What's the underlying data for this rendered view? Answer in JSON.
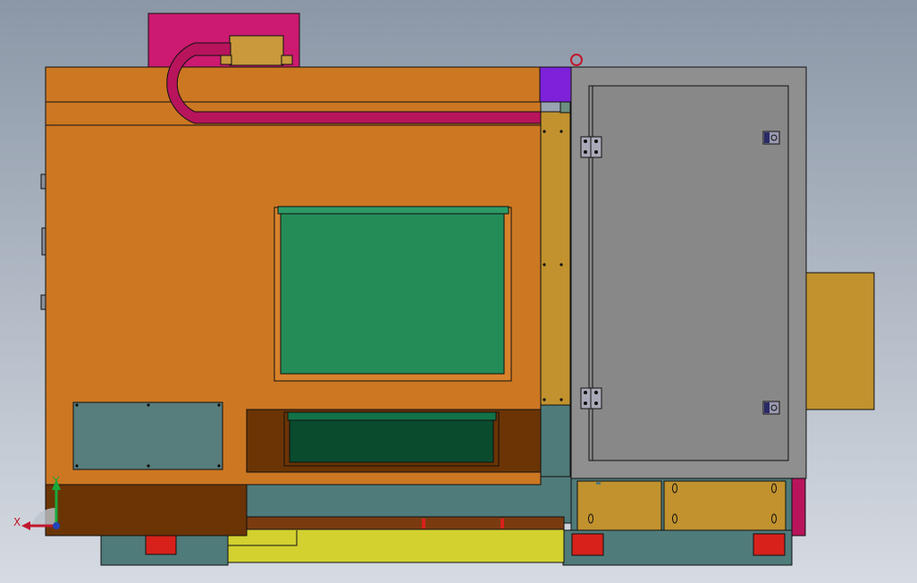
{
  "view": {
    "kind": "cad-orthographic-view",
    "background": [
      "#8b97a7",
      "#d6dbe2"
    ]
  },
  "triad": {
    "x_label": "X",
    "y_label": "Y",
    "x_color": "#c0192c",
    "y_color": "#19a83b"
  },
  "colors": {
    "enclosure_orange": "#cc7722",
    "trim_orange": "#d9822b",
    "cable_chain": "#b8145c",
    "magenta_plate": "#cc1a70",
    "tan": "#c1922e",
    "purple": "#7d22d8",
    "window_green": "#248c57",
    "dark_green": "#0a4b2e",
    "brown": "#6b3405",
    "teal": "#4f7b7a",
    "slate_panel": "#577d7c",
    "yellow": "#d3d130",
    "red_foot": "#d8211b",
    "cabinet_grey": "#8f8f8f",
    "door_grey": "#888888",
    "hinge": "#a9a9b8"
  }
}
